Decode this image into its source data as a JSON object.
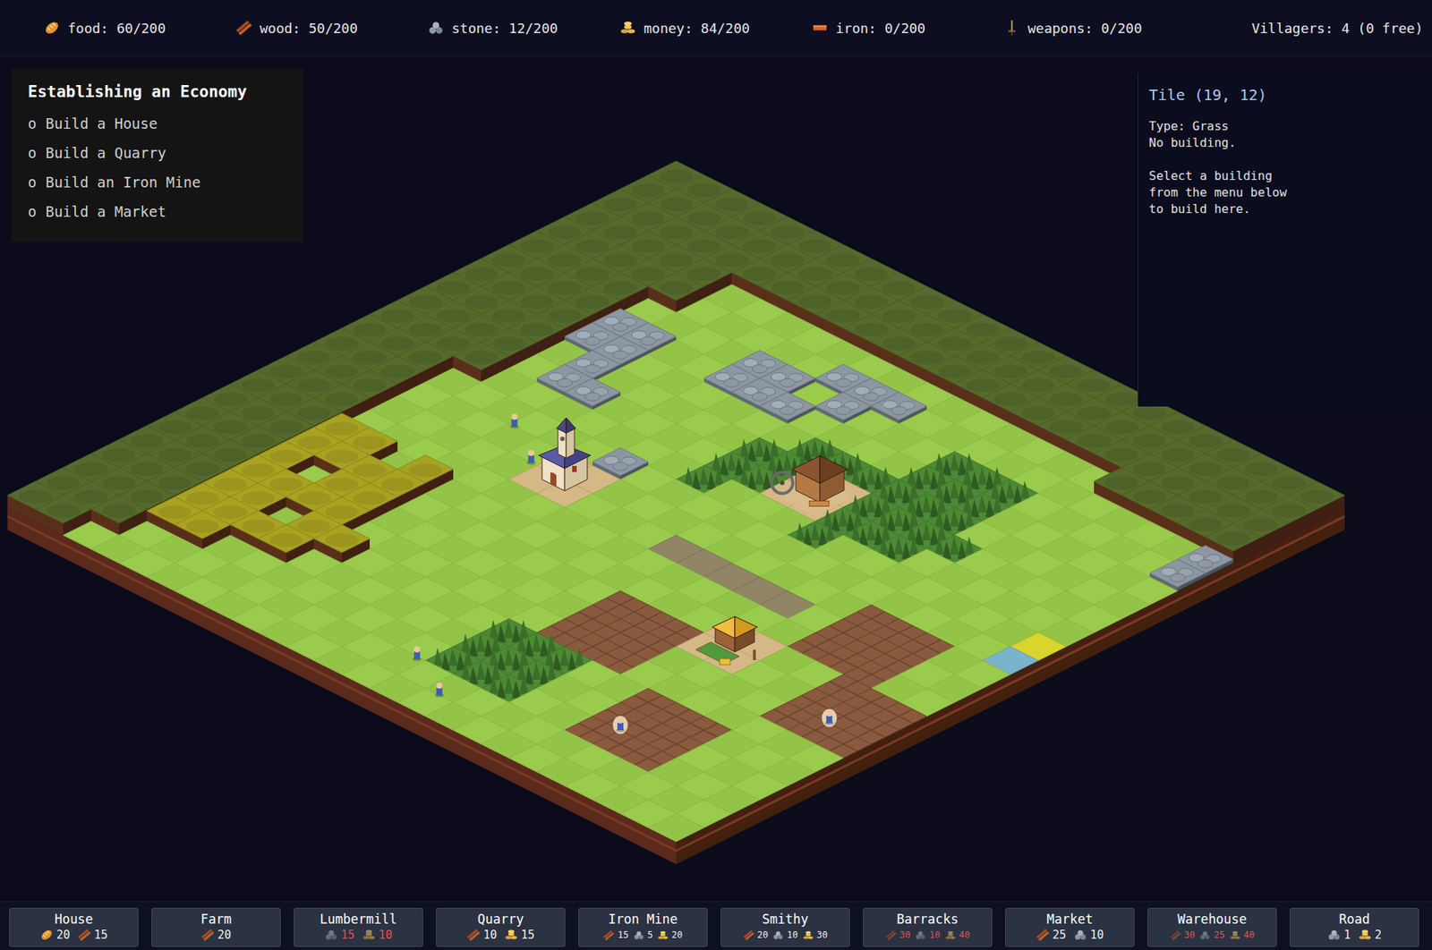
{
  "resources": [
    {
      "kind": "food",
      "text": "food: 60/200"
    },
    {
      "kind": "wood",
      "text": "wood: 50/200"
    },
    {
      "kind": "stone",
      "text": "stone: 12/200"
    },
    {
      "kind": "money",
      "text": "money: 84/200"
    },
    {
      "kind": "iron",
      "text": "iron: 0/200"
    },
    {
      "kind": "weapons",
      "text": "weapons: 0/200"
    }
  ],
  "villagers_label": "Villagers: 4 (0 free)",
  "quest": {
    "title": "Establishing an Economy",
    "tasks": [
      {
        "bullet": "o",
        "text": "Build a House",
        "done": false
      },
      {
        "bullet": "o",
        "text": "Build a Quarry",
        "done": false
      },
      {
        "bullet": "o",
        "text": "Build an Iron Mine",
        "done": false
      },
      {
        "bullet": "o",
        "text": "Build a Market",
        "done": false
      }
    ]
  },
  "tile_info": {
    "title": "Tile (19, 12)",
    "details": [
      "Type: Grass",
      "No building."
    ],
    "hint": [
      "Select a building",
      "from the menu below",
      "to build here."
    ]
  },
  "map": {
    "rows": [
      "FFFFFFFFFFFFFFFFFFFFFFFF",
      "FFFFFFFFFFFFFFFFFFFFFFFF",
      "FFFFFFFFFFFFFFFFFFFFFFFF",
      "FFFFFggggggggggggggFFFFF",
      "FFFFFgggggsssggggggggggs",
      "FFFFggggssgsgggbbbgggggs",
      "FFFFssggsssggggbbbgggggg",
      "FFFFssggggggbbbbbbgggggg",
      "FFFFgsgggggbbllbbbbggggg",
      "FFFFgssggggbbllbbbgggggg",
      "FFFFgggggggbgggbgggggggh",
      "FFFggggggsgggggggggggggw",
      "FFFgggggllgggggggggdddgg",
      "FFFgggggllgggrrrrrgdddgg",
      "FFFggggggggggggggggdddgg",
      "FFFAAgAggggggggggllggddd",
      "FFFAAAAgggggggdddllggddd",
      "FFFAgAAgggggggdddggggddd",
      "FFFAAAAgggggggdddggggggg",
      "FFFAAgAAgggggbbbggdddggg",
      "FFFAAAAggggggbbbggdddggg",
      "FFFAAggggggggbbbggdddggg",
      "FFFggggggggggggggggggggg",
      "FFgggggggggggggggggggggg"
    ],
    "buildings": [
      {
        "kind": "church",
        "x": 9,
        "y": 13
      },
      {
        "kind": "lumbermill",
        "x": 14,
        "y": 9
      },
      {
        "kind": "farm",
        "x": 18,
        "y": 16
      }
    ],
    "villagers": [
      {
        "x": 6.2,
        "y": 12.0,
        "working": false
      },
      {
        "x": 7.8,
        "y": 13.0,
        "working": false
      },
      {
        "x": 12.8,
        "y": 22.1,
        "working": false
      },
      {
        "x": 14.5,
        "y": 23.0,
        "working": false
      },
      {
        "x": 19.0,
        "y": 21.0,
        "working": true
      },
      {
        "x": 22.5,
        "y": 17.0,
        "working": true
      }
    ]
  },
  "build_menu": [
    {
      "label": "House",
      "selected": false,
      "costs": [
        {
          "kind": "food",
          "amount": "20",
          "short": false
        },
        {
          "kind": "wood",
          "amount": "15",
          "short": false
        }
      ]
    },
    {
      "label": "Farm",
      "selected": false,
      "costs": [
        {
          "kind": "wood",
          "amount": "20",
          "short": false
        }
      ]
    },
    {
      "label": "Lumbermill",
      "selected": false,
      "costs": [
        {
          "kind": "stone",
          "amount": "15",
          "short": true
        },
        {
          "kind": "money",
          "amount": "10",
          "short": true
        }
      ]
    },
    {
      "label": "Quarry",
      "selected": false,
      "costs": [
        {
          "kind": "wood",
          "amount": "10",
          "short": false
        },
        {
          "kind": "money",
          "amount": "15",
          "short": false
        }
      ]
    },
    {
      "label": "Iron Mine",
      "selected": false,
      "costs": [
        {
          "kind": "wood",
          "amount": "15",
          "short": false
        },
        {
          "kind": "stone",
          "amount": "5",
          "short": false
        },
        {
          "kind": "money",
          "amount": "20",
          "short": false
        }
      ]
    },
    {
      "label": "Smithy",
      "selected": false,
      "costs": [
        {
          "kind": "wood",
          "amount": "20",
          "short": false
        },
        {
          "kind": "stone",
          "amount": "10",
          "short": false
        },
        {
          "kind": "money",
          "amount": "30",
          "short": false
        }
      ]
    },
    {
      "label": "Barracks",
      "selected": false,
      "costs": [
        {
          "kind": "wood",
          "amount": "30",
          "short": true
        },
        {
          "kind": "stone",
          "amount": "10",
          "short": true
        },
        {
          "kind": "money",
          "amount": "40",
          "short": true
        }
      ]
    },
    {
      "label": "Market",
      "selected": false,
      "costs": [
        {
          "kind": "wood",
          "amount": "25",
          "short": false
        },
        {
          "kind": "stone",
          "amount": "10",
          "short": false
        }
      ]
    },
    {
      "label": "Warehouse",
      "selected": false,
      "costs": [
        {
          "kind": "wood",
          "amount": "30",
          "short": true
        },
        {
          "kind": "stone",
          "amount": "25",
          "short": true
        },
        {
          "kind": "money",
          "amount": "40",
          "short": true
        }
      ]
    },
    {
      "label": "Road",
      "selected": false,
      "costs": [
        {
          "kind": "stone",
          "amount": "1",
          "short": false
        },
        {
          "kind": "money",
          "amount": "2",
          "short": false
        }
      ]
    }
  ]
}
